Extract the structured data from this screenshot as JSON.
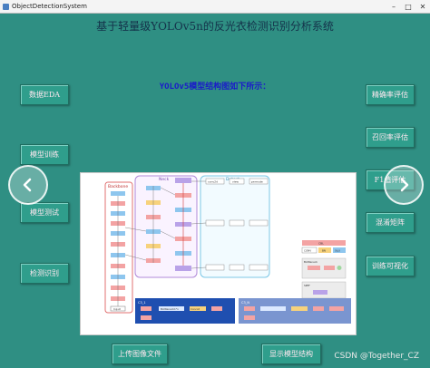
{
  "window": {
    "title": "ObjectDetectionSystem"
  },
  "header": {
    "title": "基于轻量级YOLOv5n的反光衣检测识别分析系统",
    "subtitle": "YOLOv5模型结构图如下所示："
  },
  "left_buttons": [
    {
      "label": "数据EDA"
    },
    {
      "label": "模型训练"
    },
    {
      "label": "模型测试"
    },
    {
      "label": "检测识别"
    }
  ],
  "right_buttons": [
    {
      "label": "精确率评估"
    },
    {
      "label": "召回率评估"
    },
    {
      "label": "F1值评估"
    },
    {
      "label": "混淆矩阵"
    },
    {
      "label": "训练可视化"
    }
  ],
  "bottom_buttons": {
    "upload": "上传图像文件",
    "show_model": "显示模型结构"
  },
  "navigation": {
    "prev": "chevron-left-icon",
    "next": "chevron-right-icon"
  },
  "diagram": {
    "backbone_label": "Backbone",
    "neck_label": "Neck",
    "detect_label": "Detect",
    "input_label": "Input",
    "upsample_label": "Upsample",
    "concat_label": "Concat",
    "conv2d_label": "conv2d",
    "view_label": "view",
    "permute_label": "permute",
    "cbl_label": "CBL",
    "csp_label": "CSP",
    "c3_label": "C3_1",
    "c3n_label": "C3_N",
    "bottleneck_label": "Bottleneck",
    "bottleneck_row_label": "Bottleneck1*n",
    "conv_label": "CONV",
    "bn_label": "BN",
    "silu_label": "SiLU",
    "add_label": "Add",
    "concat_box_label": "Concat",
    "sppf_label": "SPPF",
    "maxpool_label": "MaxPool"
  },
  "watermark": "CSDN @Together_CZ",
  "colors": {
    "background": "#2f8f83",
    "button": "#2f9e8c",
    "button_text": "#ffe8f0",
    "title": "#14324a",
    "subtitle": "#1b1bc9"
  }
}
